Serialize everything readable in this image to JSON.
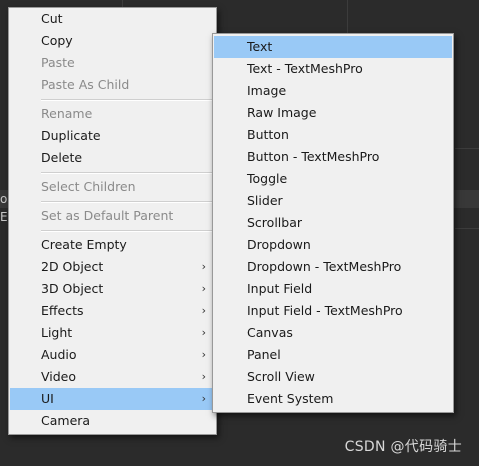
{
  "main_menu": {
    "items": [
      {
        "label": "Cut"
      },
      {
        "label": "Copy"
      },
      {
        "label": "Paste"
      },
      {
        "label": "Paste As Child"
      },
      {
        "label": "Rename"
      },
      {
        "label": "Duplicate"
      },
      {
        "label": "Delete"
      },
      {
        "label": "Select Children"
      },
      {
        "label": "Set as Default Parent"
      },
      {
        "label": "Create Empty"
      },
      {
        "label": "2D Object",
        "arrow": "›"
      },
      {
        "label": "3D Object",
        "arrow": "›"
      },
      {
        "label": "Effects",
        "arrow": "›"
      },
      {
        "label": "Light",
        "arrow": "›"
      },
      {
        "label": "Audio",
        "arrow": "›"
      },
      {
        "label": "Video",
        "arrow": "›"
      },
      {
        "label": "UI",
        "arrow": "›"
      },
      {
        "label": "Camera"
      }
    ]
  },
  "submenu_ui": {
    "items": [
      {
        "label": "Text"
      },
      {
        "label": "Text - TextMeshPro"
      },
      {
        "label": "Image"
      },
      {
        "label": "Raw Image"
      },
      {
        "label": "Button"
      },
      {
        "label": "Button - TextMeshPro"
      },
      {
        "label": "Toggle"
      },
      {
        "label": "Slider"
      },
      {
        "label": "Scrollbar"
      },
      {
        "label": "Dropdown"
      },
      {
        "label": "Dropdown - TextMeshPro"
      },
      {
        "label": "Input Field"
      },
      {
        "label": "Input Field - TextMeshPro"
      },
      {
        "label": "Canvas"
      },
      {
        "label": "Panel"
      },
      {
        "label": "Scroll View"
      },
      {
        "label": "Event System"
      }
    ]
  },
  "background": {
    "edge_text_1": "or",
    "edge_text_2": "E"
  },
  "watermark": "CSDN @代码骑士",
  "colors": {
    "menu_bg": "#f0f0f0",
    "highlight": "#99c9f6",
    "disabled_text": "#8a8a8a",
    "editor_bg": "#2b2b2b"
  }
}
